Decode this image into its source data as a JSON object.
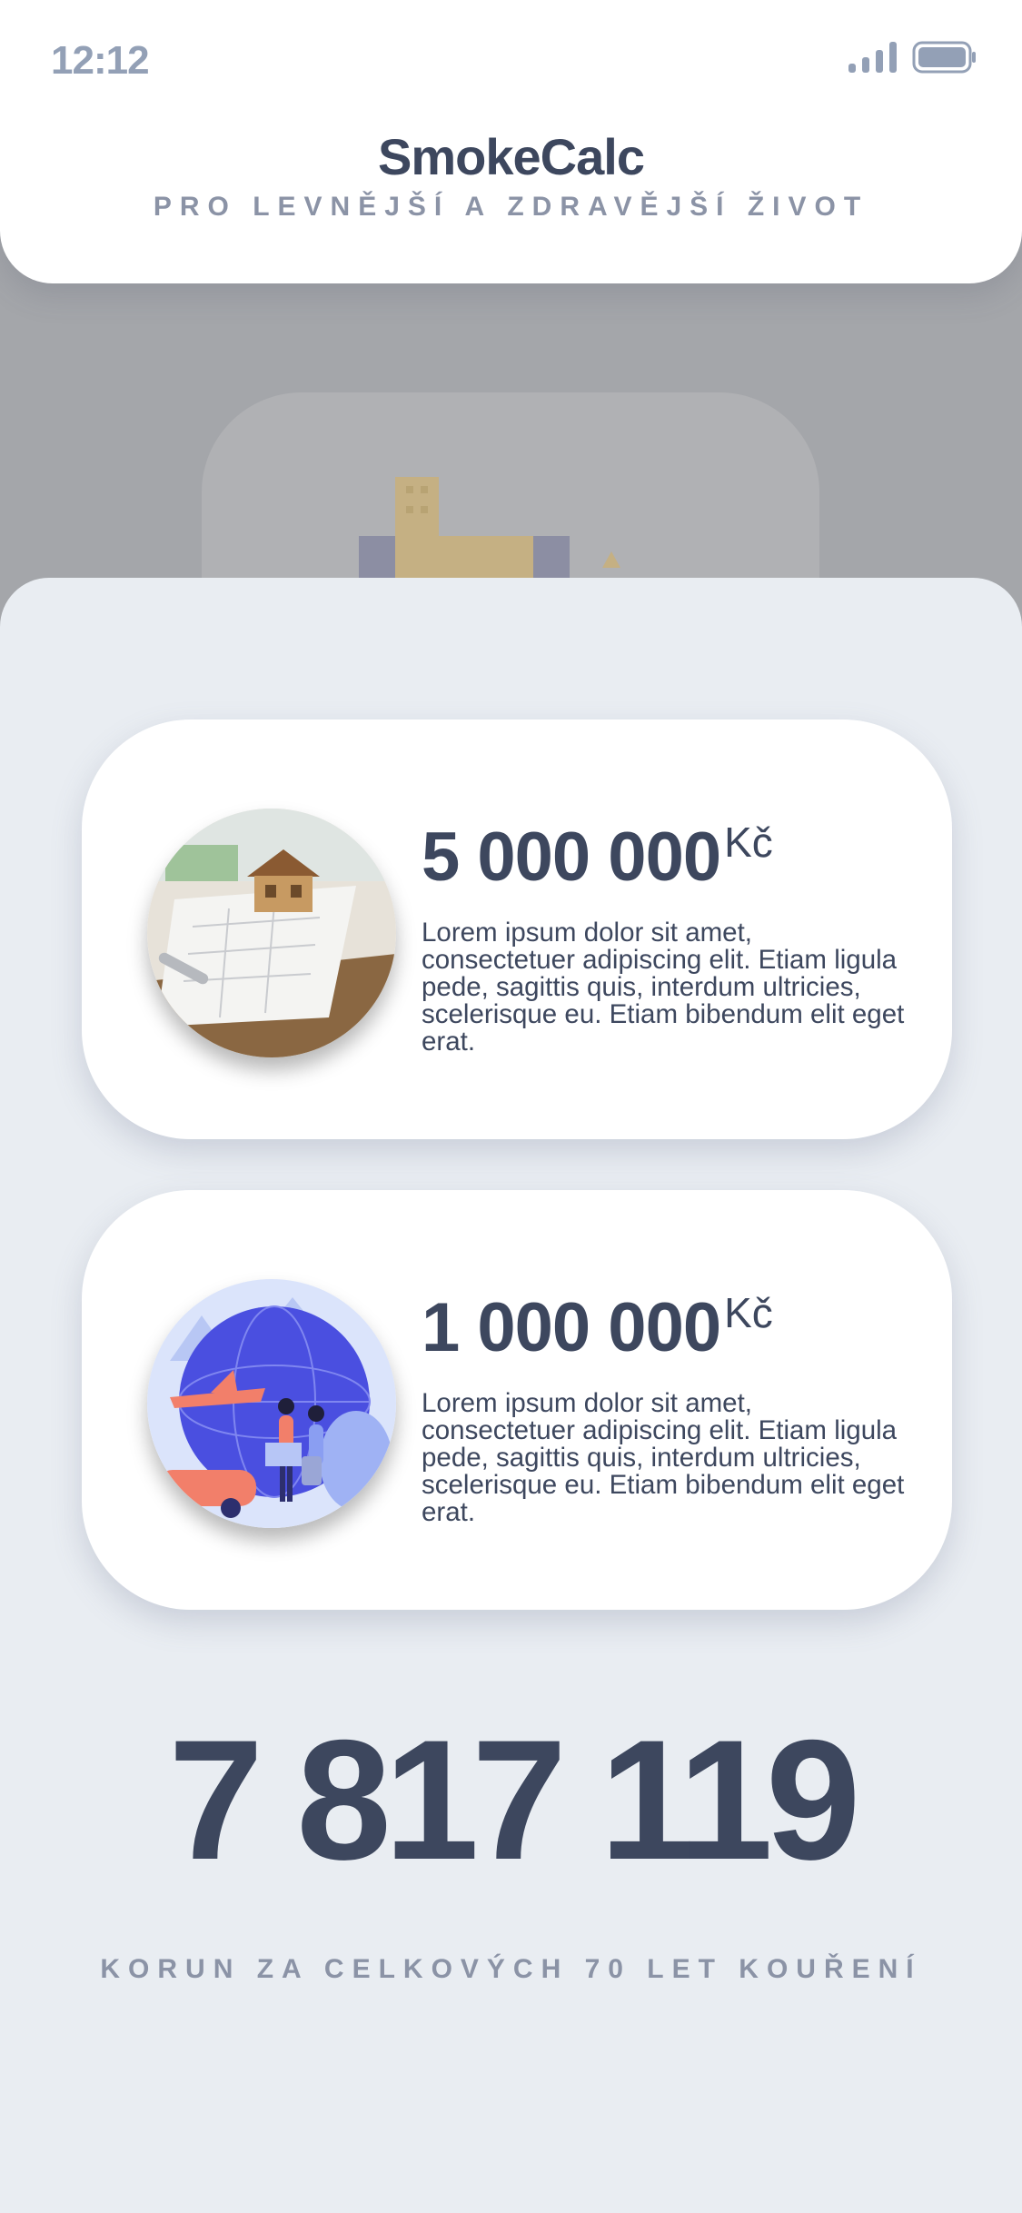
{
  "status_bar": {
    "time": "12:12",
    "signal_icon": "signal-icon",
    "battery_icon": "battery-icon"
  },
  "header": {
    "title": "SmokeCalc",
    "subtitle": "PRO LEVNĚJŠÍ A ZDRAVĚJŠÍ ŽIVOT"
  },
  "cards": [
    {
      "amount": "5 000 000",
      "currency": "Kč",
      "description": "Lorem ipsum dolor sit amet, consectetuer adipiscing elit. Etiam ligula pede, sagittis quis, interdum ultricies, scelerisque eu. Etiam bibendum elit eget erat.",
      "image": "house-model-photo"
    },
    {
      "amount": "1 000 000",
      "currency": "Kč",
      "description": "Lorem ipsum dolor sit amet, consectetuer adipiscing elit. Etiam ligula pede, sagittis quis, interdum ultricies, scelerisque eu. Etiam bibendum elit eget erat.",
      "image": "travel-illustration"
    }
  ],
  "total": {
    "value": "7 817 119",
    "caption": "KORUN ZA CELKOVÝCH 70 LET KOUŘENÍ"
  },
  "colors": {
    "text_dark": "#3d475e",
    "text_muted": "#8b93a6",
    "sheet_background": "#e9edf2",
    "overlay_background": "#a4a6aa"
  }
}
